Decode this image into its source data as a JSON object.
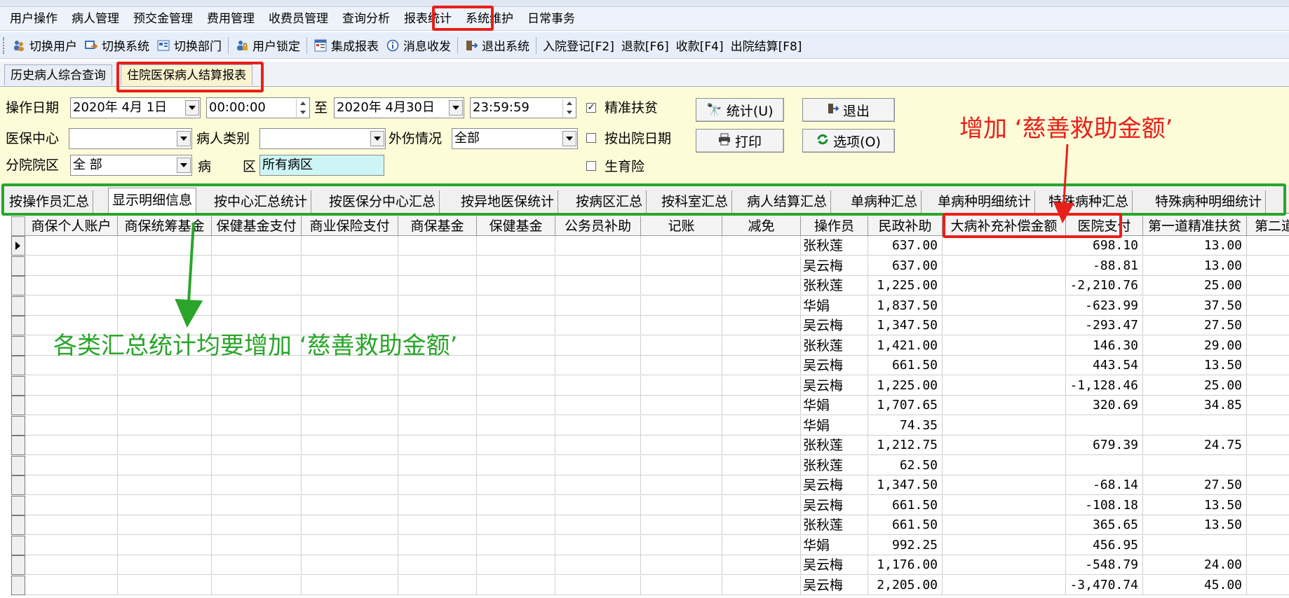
{
  "menu": [
    "用户操作",
    "病人管理",
    "预交金管理",
    "费用管理",
    "收费员管理",
    "查询分析",
    "报表统计",
    "系统维护",
    "日常事务"
  ],
  "toolbar": [
    {
      "label": "切换用户",
      "icon": "users-icon"
    },
    {
      "label": "切换系统",
      "icon": "switch-system-icon"
    },
    {
      "label": "切换部门",
      "icon": "department-icon"
    },
    {
      "label": "用户锁定",
      "icon": "lock-icon"
    },
    {
      "label": "集成报表",
      "icon": "report-icon"
    },
    {
      "label": "消息收发",
      "icon": "info-icon"
    },
    {
      "label": "退出系统",
      "icon": "exit-icon"
    },
    {
      "label": "入院登记[F2]"
    },
    {
      "label": "退款[F6]"
    },
    {
      "label": "收款[F4]"
    },
    {
      "label": "出院结算[F8]"
    }
  ],
  "doc_tabs": [
    "历史病人综合查询",
    "住院医保病人结算报表"
  ],
  "filters": {
    "date_label": "操作日期",
    "date_from": "2020年 4月 1日",
    "time_from": "00:00:00",
    "to_label": "至",
    "date_to": "2020年 4月30日",
    "time_to": "23:59:59",
    "precise_poverty": "精准扶贫",
    "insurance_center_label": "医保中心",
    "insurance_center_value": "",
    "patient_type_label": "病人类别",
    "patient_type_value": "",
    "injury_label": "外伤情况",
    "injury_value": "全部",
    "by_discharge_date": "按出院日期",
    "branch_label": "分院院区",
    "branch_value": "全 部",
    "ward_label_1": "病",
    "ward_label_2": "区",
    "ward_value": "所有病区",
    "maternity": "生育险"
  },
  "buttons": {
    "stats": "统计(U)",
    "exit": "退出",
    "print": "打印",
    "options": "选项(O)"
  },
  "report_tabs": [
    "按操作员汇总",
    "显示明细信息",
    "按中心汇总统计",
    "按医保分中心汇总",
    "按异地医保统计",
    "按病区汇总",
    "按科室汇总",
    "病人结算汇总",
    "单病种汇总",
    "单病种明细统计",
    "特殊病种汇总",
    "特殊病种明细统计"
  ],
  "grid": {
    "columns": [
      "商保个人账户",
      "商保统筹基金",
      "保健基金支付",
      "商业保险支付",
      "商保基金",
      "保健基金",
      "公务员补助",
      "记账",
      "减免",
      "操作员",
      "民政补助",
      "大病补充补偿金额",
      "医院支付",
      "第一道精准扶贫",
      "第二道"
    ],
    "rows": [
      {
        "operator": "张秋莲",
        "civil": "637.00",
        "hospital": "698.10",
        "first": "13.00"
      },
      {
        "operator": "吴云梅",
        "civil": "637.00",
        "hospital": "-88.81",
        "first": "13.00"
      },
      {
        "operator": "张秋莲",
        "civil": "1,225.00",
        "hospital": "-2,210.76",
        "first": "25.00"
      },
      {
        "operator": "华娟",
        "civil": "1,837.50",
        "hospital": "-623.99",
        "first": "37.50"
      },
      {
        "operator": "吴云梅",
        "civil": "1,347.50",
        "hospital": "-293.47",
        "first": "27.50"
      },
      {
        "operator": "张秋莲",
        "civil": "1,421.00",
        "hospital": "146.30",
        "first": "29.00"
      },
      {
        "operator": "吴云梅",
        "civil": "661.50",
        "hospital": "443.54",
        "first": "13.50"
      },
      {
        "operator": "吴云梅",
        "civil": "1,225.00",
        "hospital": "-1,128.46",
        "first": "25.00"
      },
      {
        "operator": "华娟",
        "civil": "1,707.65",
        "hospital": "320.69",
        "first": "34.85"
      },
      {
        "operator": "华娟",
        "civil": "74.35",
        "hospital": "",
        "first": ""
      },
      {
        "operator": "张秋莲",
        "civil": "1,212.75",
        "hospital": "679.39",
        "first": "24.75"
      },
      {
        "operator": "张秋莲",
        "civil": "62.50",
        "hospital": "",
        "first": ""
      },
      {
        "operator": "吴云梅",
        "civil": "1,347.50",
        "hospital": "-68.14",
        "first": "27.50"
      },
      {
        "operator": "吴云梅",
        "civil": "661.50",
        "hospital": "-108.18",
        "first": "13.50"
      },
      {
        "operator": "张秋莲",
        "civil": "661.50",
        "hospital": "365.65",
        "first": "13.50"
      },
      {
        "operator": "华娟",
        "civil": "992.25",
        "hospital": "456.95",
        "first": ""
      },
      {
        "operator": "吴云梅",
        "civil": "1,176.00",
        "hospital": "-548.79",
        "first": "24.00"
      },
      {
        "operator": "吴云梅",
        "civil": "2,205.00",
        "hospital": "-3,470.74",
        "first": "45.00"
      }
    ]
  },
  "annotations": {
    "red_note": "增加 ‘慈善救助金额’",
    "green_note": "各类汇总统计均要增加 ‘慈善救助金额’",
    "red_color": "#e8201a",
    "green_color": "#2aa52a"
  }
}
